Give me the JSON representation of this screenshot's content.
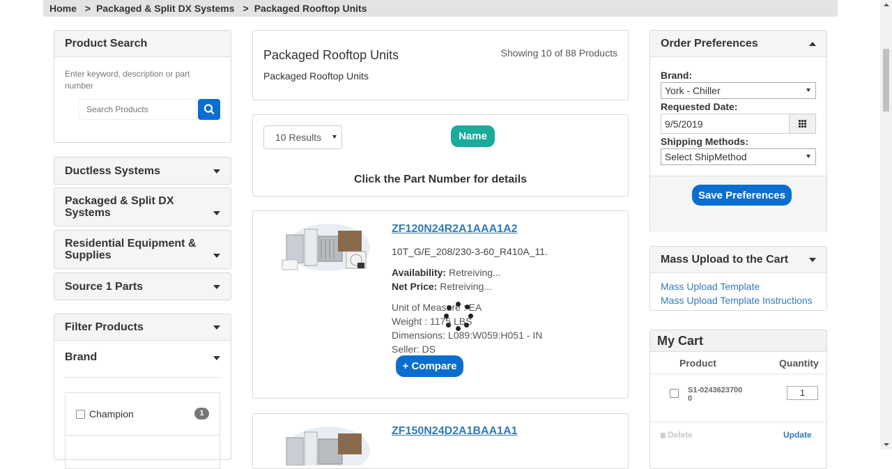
{
  "breadcrumb": {
    "items": [
      "Home",
      "Packaged & Split DX Systems",
      "Packaged Rooftop Units"
    ],
    "separator": ">"
  },
  "sidebar": {
    "search": {
      "title": "Product Search",
      "hint": "Enter keyword, description or part number",
      "placeholder": "Search Products",
      "icon": "search-icon"
    },
    "categories": [
      {
        "label": "Ductless Systems"
      },
      {
        "label": "Packaged & Split DX Systems"
      },
      {
        "label": "Residential Equipment & Supplies"
      },
      {
        "label": "Source 1 Parts"
      }
    ],
    "filter": {
      "title": "Filter Products",
      "brand_title": "Brand",
      "brands": [
        {
          "label": "Champion",
          "count": "1"
        }
      ]
    }
  },
  "main": {
    "header": {
      "title": "Packaged Rooftop Units",
      "subtitle": "Packaged Rooftop Units",
      "showing": "Showing 10 of 88 Products"
    },
    "toolbar": {
      "results_select": "10 Results",
      "sort_button": "Name",
      "hint": "Click the Part Number for details"
    },
    "products": [
      {
        "part_number": "ZF120N24R2A1AAA1A2",
        "description": "10T_G/E_208/230-3-60_R410A_11.",
        "availability_label": "Availability:",
        "availability": "Retreiving...",
        "price_label": "Net Price:",
        "price": "Retreiving...",
        "uom": "Unit of Measure : EA",
        "weight": "Weight : 1175 LBS",
        "dimensions": "Dimensions: L089:W059:H051 - IN",
        "seller": "Seller: DS",
        "compare": "+ Compare"
      },
      {
        "part_number": "ZF150N24D2A1BAA1A1"
      }
    ]
  },
  "right": {
    "order_prefs": {
      "title": "Order Preferences",
      "brand_label": "Brand:",
      "brand_value": "York - Chiller",
      "date_label": "Requested Date:",
      "date_value": "9/5/2019",
      "shipping_label": "Shipping Methods:",
      "shipping_value": "Select ShipMethod",
      "save": "Save Preferences"
    },
    "mass_upload": {
      "title": "Mass Upload to the Cart",
      "links": [
        "Mass Upload Template",
        "Mass Upload Template Instructions"
      ]
    },
    "cart": {
      "title": "My Cart",
      "col_product": "Product",
      "col_quantity": "Quantity",
      "items": [
        {
          "product": "S1-02436237000",
          "quantity": "1"
        }
      ],
      "delete": "Delete",
      "update": "Update"
    }
  },
  "colors": {
    "accent_blue": "#0a6ed1",
    "teal": "#1aab9b",
    "link": "#337ab7"
  }
}
